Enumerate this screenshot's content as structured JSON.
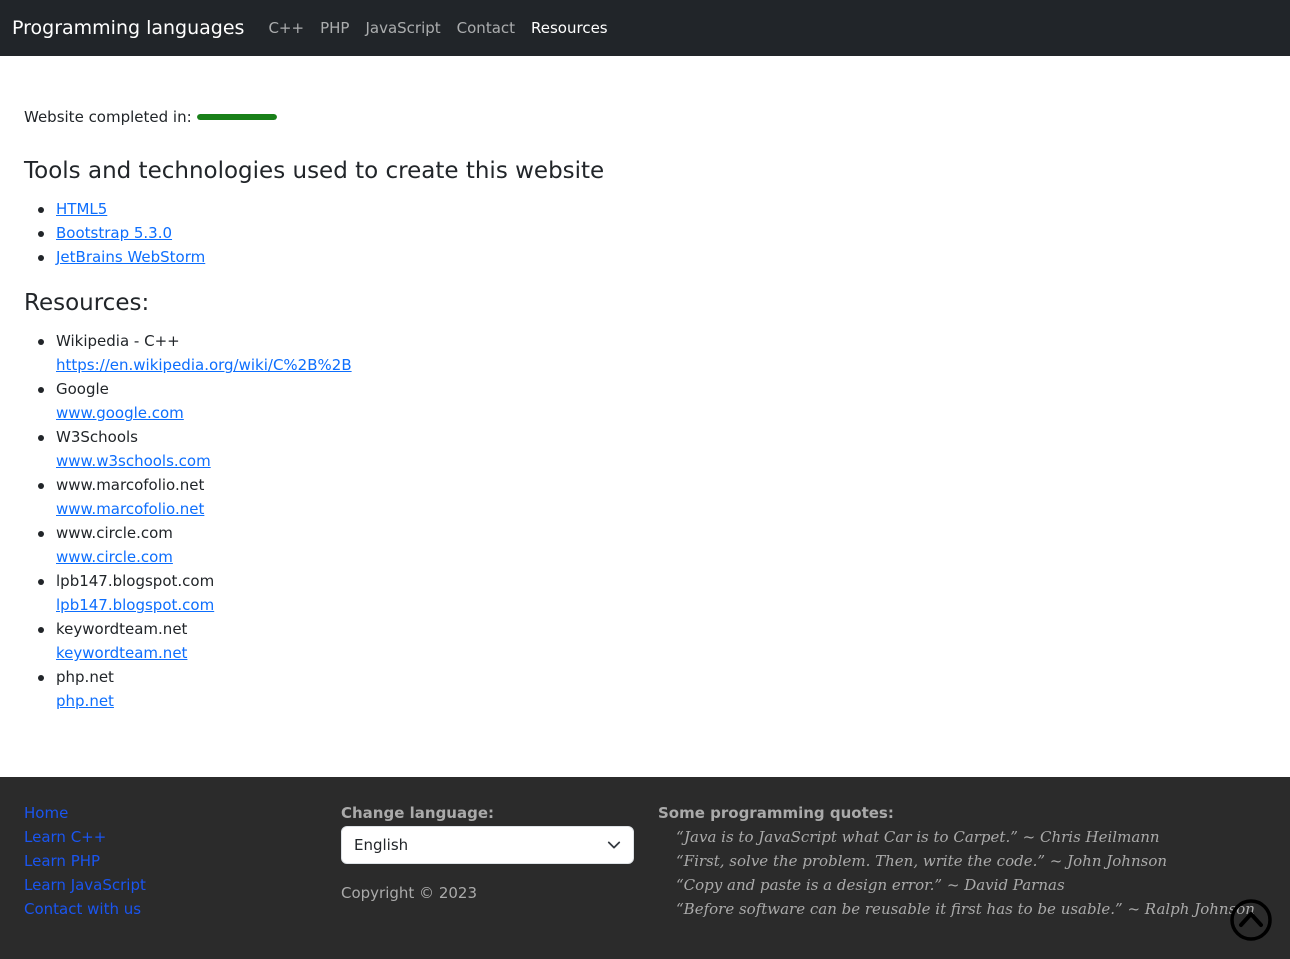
{
  "navbar": {
    "brand": "Programming languages",
    "links": [
      {
        "label": "C++",
        "active": false
      },
      {
        "label": "PHP",
        "active": false
      },
      {
        "label": "JavaScript",
        "active": false
      },
      {
        "label": "Contact",
        "active": false
      },
      {
        "label": "Resources",
        "active": true
      }
    ]
  },
  "progress": {
    "label": "Website completed in:",
    "value_fraction": 1.0,
    "color": "#198019"
  },
  "tools": {
    "heading": "Tools and technologies used to create this website",
    "items": [
      "HTML5",
      "Bootstrap 5.3.0",
      "JetBrains WebStorm"
    ]
  },
  "resources": {
    "heading": "Resources:",
    "items": [
      {
        "name": "Wikipedia - C++",
        "url": "https://en.wikipedia.org/wiki/C%2B%2B"
      },
      {
        "name": "Google",
        "url": "www.google.com"
      },
      {
        "name": "W3Schools",
        "url": "www.w3schools.com"
      },
      {
        "name": "www.marcofolio.net",
        "url": "www.marcofolio.net"
      },
      {
        "name": "www.circle.com",
        "url": "www.circle.com"
      },
      {
        "name": "lpb147.blogspot.com",
        "url": "lpb147.blogspot.com"
      },
      {
        "name": "keywordteam.net",
        "url": "keywordteam.net"
      },
      {
        "name": "php.net",
        "url": "php.net"
      }
    ]
  },
  "footer": {
    "links": [
      "Home",
      "Learn C++",
      "Learn PHP",
      "Learn JavaScript",
      "Contact with us"
    ],
    "language_label": "Change language:",
    "language_selected": "English",
    "copyright": "Copyright © 2023",
    "quotes_heading": "Some programming quotes:",
    "quotes": [
      "“Java is to JavaScript what Car is to Carpet.” ~ Chris Heilmann",
      "“First, solve the problem. Then, write the code.” ~ John Johnson",
      "“Copy and paste is a design error.” ~ David Parnas",
      "“Before software can be reusable it first has to be usable.” ~ Ralph Johnson"
    ],
    "scroll_top_icon": "chevron-up-circle-icon"
  }
}
